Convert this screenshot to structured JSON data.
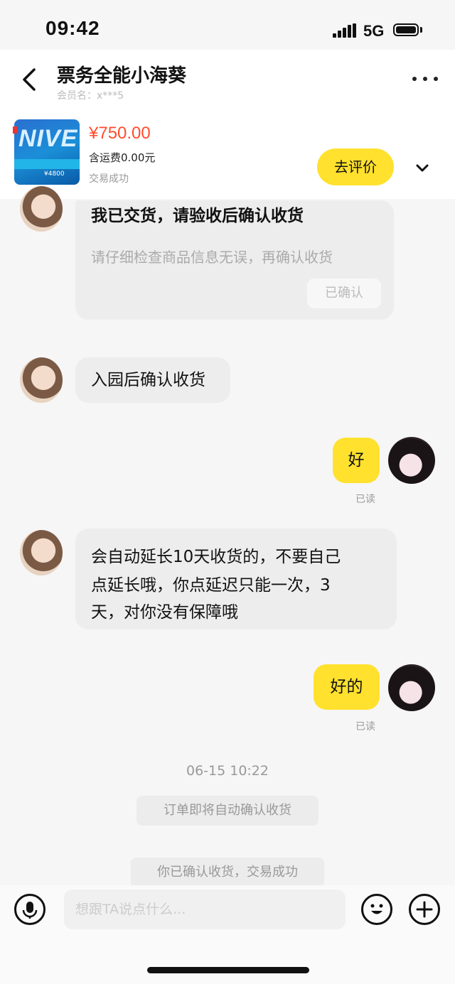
{
  "status_bar": {
    "time": "09:42",
    "network": "5G"
  },
  "header": {
    "title": "票务全能小海葵",
    "subtitle": "会员名：x***5"
  },
  "product": {
    "image_text": "NIVE",
    "image_caption": "¥4800",
    "price": "¥750.00",
    "shipping": "含运费0.00元",
    "status": "交易成功",
    "rate_button": "去评价"
  },
  "messages": {
    "card": {
      "title": "我已交货，请验收后确认收货",
      "desc": "请仔细检查商品信息无误，再确认收货",
      "button": "已确认"
    },
    "m1": "入园后确认收货",
    "m2": {
      "text": "好",
      "status": "已读"
    },
    "m3": [
      "会自动延长10天收货的，不要自己",
      "点延长哦，你点延迟只能一次，3",
      "天，对你没有保障哦"
    ],
    "m4": {
      "text": "好的",
      "status": "已读"
    },
    "timestamp": "06-15 10:22",
    "system_1": "订单即将自动确认收货",
    "system_2": "你已确认收货，交易成功"
  },
  "input_bar": {
    "placeholder": "想跟TA说点什么..."
  },
  "colors": {
    "accent": "#ffe12e",
    "price": "#ff4d2d"
  },
  "icons": [
    "back-arrow-icon",
    "more-dots-icon",
    "chevron-down-icon",
    "microphone-icon",
    "emoji-icon",
    "plus-icon"
  ]
}
